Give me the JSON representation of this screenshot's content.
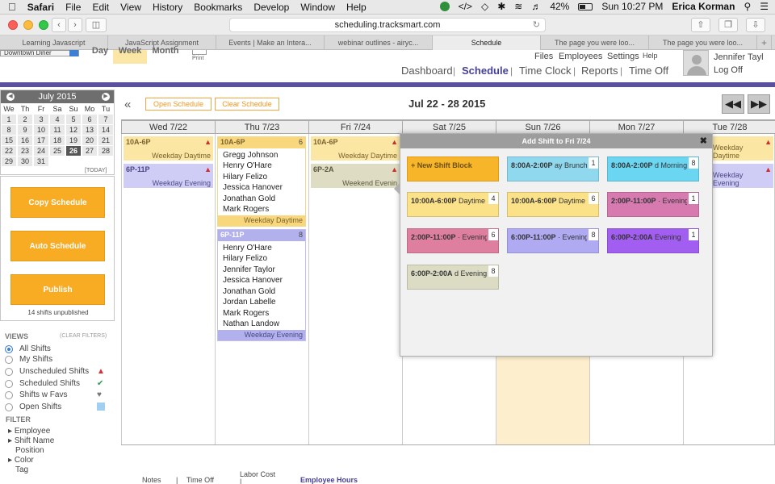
{
  "menubar": {
    "apple": "",
    "app": "Safari",
    "items": [
      "File",
      "Edit",
      "View",
      "History",
      "Bookmarks",
      "Develop",
      "Window",
      "Help"
    ],
    "battery": "42%",
    "clock": "Sun 10:27 PM",
    "user": "Erica Korman"
  },
  "browser": {
    "url": "scheduling.tracksmart.com",
    "tabs": [
      "Learning Javascript",
      "JavaScript Assignment",
      "Events | Make an Intera...",
      "webinar outlines - airyc...",
      "Schedule",
      "The page you were loo...",
      "The page you were loo..."
    ]
  },
  "header": {
    "location": "Downtown Diner",
    "view_tabs": [
      "Day",
      "Week",
      "Month"
    ],
    "print": "Print",
    "nav": [
      "Dashboard",
      "Schedule",
      "Time Clock",
      "Reports",
      "Time Off"
    ],
    "top_links": [
      "Files",
      "Employees",
      "Settings",
      "Help"
    ],
    "user_name": "Jennifer Tayl",
    "logoff": "Log Off"
  },
  "calendar": {
    "month": "July 2015",
    "weekdays": [
      "We",
      "Th",
      "Fr",
      "Sa",
      "Su",
      "Mo",
      "Tu"
    ],
    "days": [
      "1",
      "2",
      "3",
      "4",
      "5",
      "6",
      "7",
      "8",
      "9",
      "10",
      "11",
      "12",
      "13",
      "14",
      "15",
      "16",
      "17",
      "18",
      "19",
      "20",
      "21",
      "22",
      "23",
      "24",
      "25",
      "26",
      "27",
      "28",
      "29",
      "30",
      "31"
    ],
    "today_day": "26",
    "today_label": "[TODAY]"
  },
  "actions": {
    "copy": "Copy Schedule",
    "auto": "Auto Schedule",
    "publish": "Publish",
    "unpublished": "14 shifts unpublished"
  },
  "views": {
    "title": "VIEWS",
    "clear": "(CLEAR FILTERS)",
    "items": [
      "All Shifts",
      "My Shifts",
      "Unscheduled Shifts",
      "Scheduled Shifts",
      "Shifts w Favs",
      "Open Shifts"
    ]
  },
  "filter": {
    "title": "FILTER",
    "items": [
      "Employee",
      "Shift Name",
      "Position",
      "Color",
      "Tag"
    ]
  },
  "schedule": {
    "open_btn": "Open Schedule",
    "clear_btn": "Clear Schedule",
    "range": "Jul 22 - 28 2015",
    "collapse": "«",
    "days": [
      "Wed 7/22",
      "Thu 7/23",
      "Fri 7/24",
      "Sat 7/25",
      "Sun 7/26",
      "Mon 7/27",
      "Tue 7/28"
    ],
    "wed": [
      {
        "time": "10A-6P",
        "name": "Weekday Daytime"
      },
      {
        "time": "6P-11P",
        "name": "Weekday Evening"
      }
    ],
    "thu": [
      {
        "time": "10A-6P",
        "name": "Weekday Daytime",
        "count": "6",
        "employees": [
          "Gregg Johnson",
          "Henry O'Hare",
          "Hilary Felizo",
          "Jessica Hanover",
          "Jonathan Gold",
          "Mark Rogers"
        ]
      },
      {
        "time": "6P-11P",
        "name": "Weekday Evening",
        "count": "8",
        "employees": [
          "Henry O'Hare",
          "Hilary Felizo",
          "Jennifer Taylor",
          "Jessica Hanover",
          "Jonathan Gold",
          "Jordan Labelle",
          "Mark Rogers",
          "Nathan Landow"
        ]
      }
    ],
    "fri": [
      {
        "time": "10A-6P",
        "name": "Weekday Daytime"
      },
      {
        "time": "6P-2A",
        "name": "Weekend Evenin"
      }
    ],
    "tue": [
      {
        "name": "Weekday Daytime"
      },
      {
        "name": "Weekday Evening"
      }
    ]
  },
  "popup": {
    "title": "Add Shift to Fri 7/24",
    "close": "✖",
    "new_block": "+ New Shift Block",
    "blocks": [
      {
        "time": "8:00A-2:00P",
        "name": "ay Brunch",
        "count": "1",
        "color": "#8fd8ee"
      },
      {
        "time": "8:00A-2:00P",
        "name": "d Morning",
        "count": "8",
        "color": "#6ad6f2"
      },
      {
        "time": "10:00A-6:00P",
        "name": "Daytime",
        "count": "4",
        "color": "#fbe187"
      },
      {
        "time": "10:00A-6:00P",
        "name": "Daytime",
        "count": "6",
        "color": "#fbe187"
      },
      {
        "time": "2:00P-11:00P",
        "name": "· Evening",
        "count": "1",
        "color": "#d67ab0"
      },
      {
        "time": "2:00P-11:00P",
        "name": "· Evening",
        "count": "6",
        "color": "#df7fa0"
      },
      {
        "time": "6:00P-11:00P",
        "name": "· Evening",
        "count": "8",
        "color": "#afaaf2"
      },
      {
        "time": "6:00P-2:00A",
        "name": "Evening",
        "count": "1",
        "color": "#a15ef0"
      },
      {
        "time": "6:00P-2:00A",
        "name": "d Evening",
        "count": "8",
        "color": "#dcdcc4"
      }
    ]
  },
  "footer": {
    "notes": "Notes",
    "timeoff": "Time Off",
    "labor": "Labor Cost",
    "hours": "Employee Hours"
  }
}
